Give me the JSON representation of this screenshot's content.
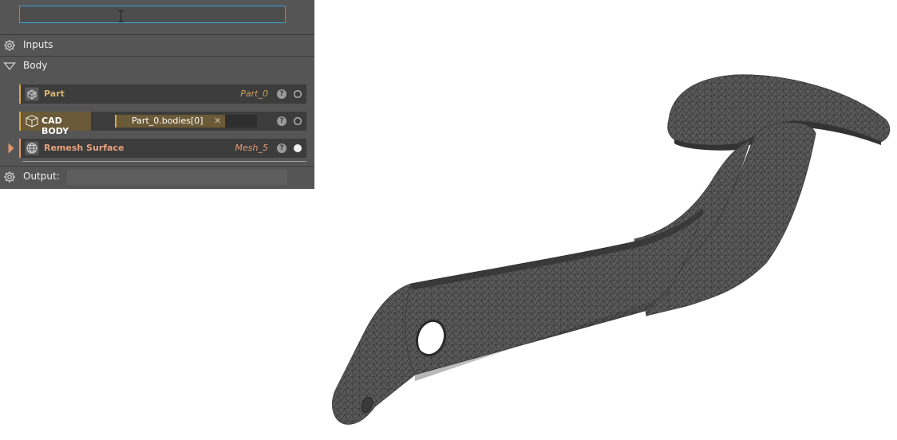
{
  "search": {
    "value": "",
    "placeholder": ""
  },
  "panel": {
    "inputs_label": "Inputs",
    "body_label": "Body",
    "output_label": "Output:",
    "output_value": ""
  },
  "rows": [
    {
      "name": "Part",
      "value": "Part_0",
      "accent": "#d8a848",
      "name_color": "#d8b46a",
      "value_color": "#c9a05a",
      "icon": "part-icon",
      "status": "empty"
    },
    {
      "name": "CAD BODY",
      "chip_value": "Part_0.bodies[0]",
      "accent": "#d8a848",
      "icon": "cad-body-icon",
      "status": "empty"
    },
    {
      "name": "Remesh Surface",
      "value": "Mesh_5",
      "accent": "#e0966a",
      "name_color": "#e9a27d",
      "value_color": "#e09a72",
      "icon": "remesh-icon",
      "status": "filled"
    }
  ],
  "help_glyph": "?",
  "remove_glyph": "✕",
  "colors": {
    "panel_bg": "#555555",
    "row_bg": "#3c3c3c",
    "search_border": "#35a4d9",
    "mesh_fill": "#5a5a5a",
    "mesh_lines": "#2a2a2a"
  }
}
